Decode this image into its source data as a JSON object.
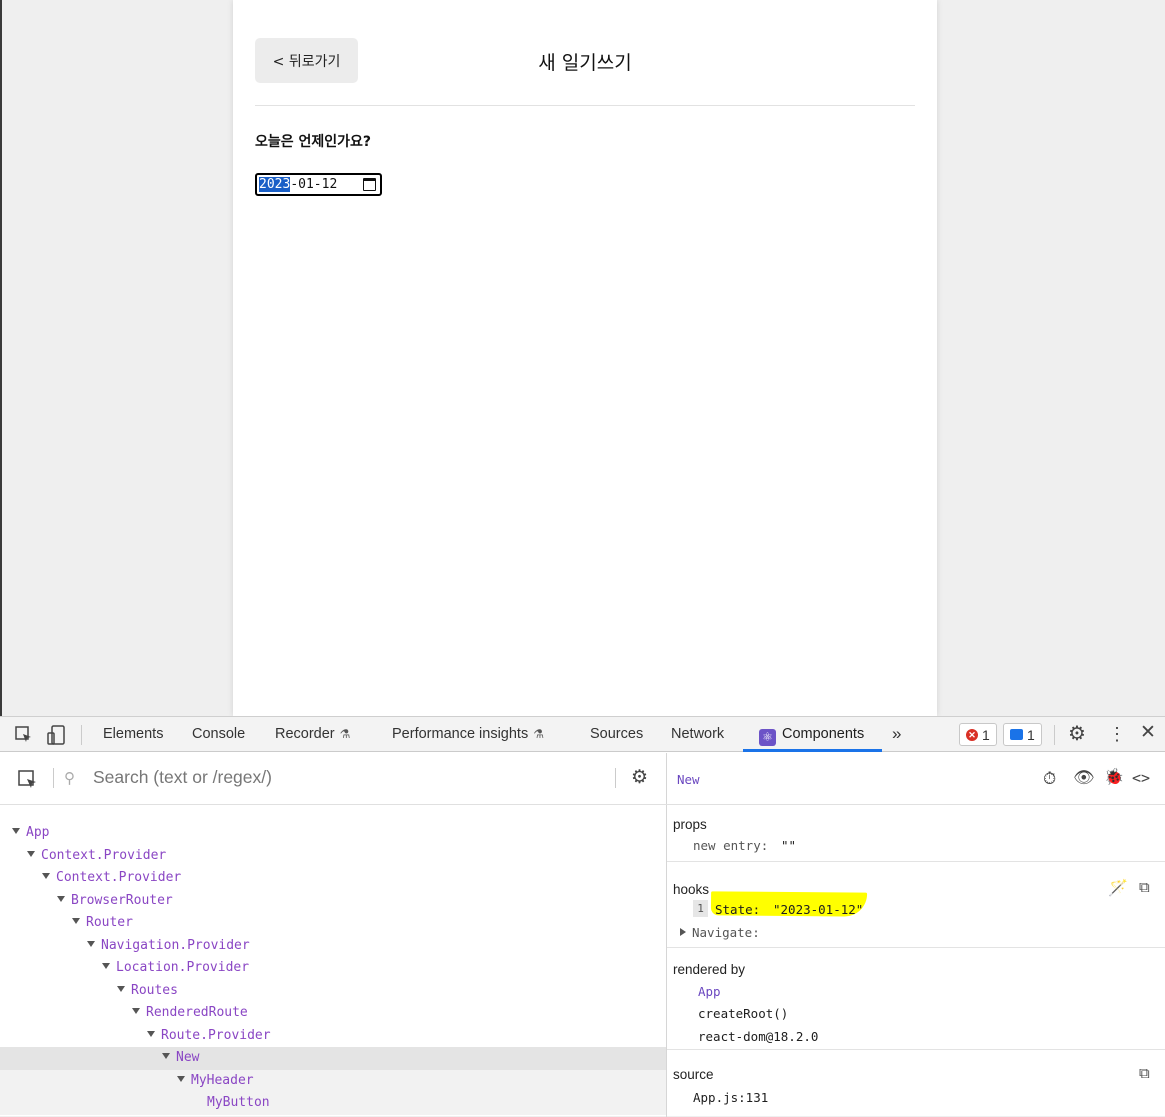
{
  "app": {
    "back_label": "< 뒤로가기",
    "title": "새 일기쓰기",
    "question": "오늘은 언제인가요?",
    "date_selected": "2023",
    "date_rest": "-01-12"
  },
  "devtools": {
    "tabs": [
      "Elements",
      "Console",
      "Recorder",
      "Performance insights",
      "Sources",
      "Network",
      "Components"
    ],
    "active_tab": "Components",
    "error_count": "1",
    "message_count": "1",
    "more": "»",
    "search_placeholder": "Search (text or /regex/)",
    "tree": [
      {
        "label": "App"
      },
      {
        "label": "Context.Provider"
      },
      {
        "label": "Context.Provider"
      },
      {
        "label": "BrowserRouter"
      },
      {
        "label": "Router"
      },
      {
        "label": "Navigation.Provider"
      },
      {
        "label": "Location.Provider"
      },
      {
        "label": "Routes"
      },
      {
        "label": "RenderedRoute"
      },
      {
        "label": "Route.Provider"
      },
      {
        "label": "New"
      },
      {
        "label": "MyHeader"
      },
      {
        "label": "MyButton"
      }
    ],
    "inspector": {
      "component_name": "New",
      "props_title": "props",
      "props_key": "new entry:",
      "props_value": "\"\"",
      "hooks_title": "hooks",
      "hook_index": "1",
      "hook_state_key": "State:",
      "hook_state_value": "\"2023-01-12\"",
      "hook_navigate": "Navigate:",
      "rendered_by_title": "rendered by",
      "rendered_by": [
        "App",
        "createRoot()",
        "react-dom@18.2.0"
      ],
      "source_title": "source",
      "source_value": "App.js:131"
    }
  }
}
